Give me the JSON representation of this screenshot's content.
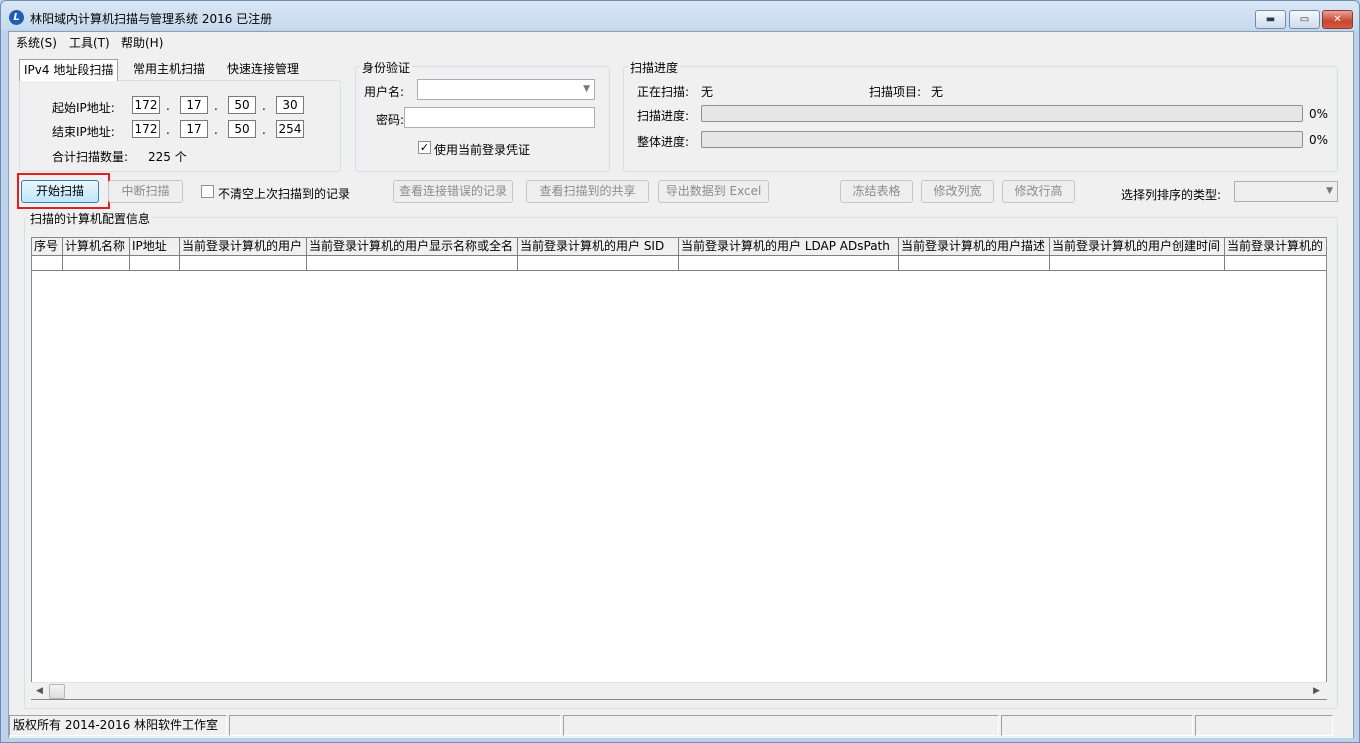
{
  "window": {
    "title": "林阳域内计算机扫描与管理系统 2016 已注册",
    "app_icon_glyph": "L",
    "min_glyph": "▬",
    "max_glyph": "▭",
    "close_glyph": "✕"
  },
  "menu": [
    "系统(S)",
    "工具(T)",
    "帮助(H)"
  ],
  "tabs": [
    "IPv4 地址段扫描",
    "常用主机扫描",
    "快速连接管理"
  ],
  "ip_range": {
    "start_label": "起始IP地址:",
    "start": [
      "172",
      "17",
      "50",
      "30"
    ],
    "end_label": "结束IP地址:",
    "end": [
      "172",
      "17",
      "50",
      "254"
    ],
    "dot": ".",
    "count_label": "合计扫描数量:",
    "count_value": "225 个"
  },
  "auth": {
    "title": "身份验证",
    "username_label": "用户名:",
    "username_value": "",
    "password_label": "密码:",
    "use_current_label": "使用当前登录凭证",
    "use_current_checked": "✓"
  },
  "progress": {
    "title": "扫描进度",
    "scanning_label": "正在扫描:",
    "scanning_value": "无",
    "item_label": "扫描项目:",
    "item_value": "无",
    "scan_progress_label": "扫描进度:",
    "scan_progress_pct": "0%",
    "scan_progress_value": 0,
    "overall_label": "整体进度:",
    "overall_pct": "0%",
    "overall_value": 0
  },
  "toolbar": {
    "start": "开始扫描",
    "stop": "中断扫描",
    "keep_records": "不清空上次扫描到的记录",
    "view_errors": "查看连接错误的记录",
    "view_shares": "查看扫描到的共享",
    "export_excel": "导出数据到 Excel",
    "freeze": "冻结表格",
    "col_width": "修改列宽",
    "row_height": "修改行高",
    "sort_label": "选择列排序的类型:",
    "sort_value": ""
  },
  "grid": {
    "title": "扫描的计算机配置信息",
    "columns": [
      "序号",
      "计算机名称",
      "IP地址",
      "当前登录计算机的用户",
      "当前登录计算机的用户显示名称或全名",
      "当前登录计算机的用户 SID",
      "当前登录计算机的用户 LDAP ADsPath",
      "当前登录计算机的用户描述",
      "当前登录计算机的用户创建时间",
      "当前登录计算机的"
    ]
  },
  "scrollbar": {
    "left_arrow": "◀",
    "right_arrow": "▶"
  },
  "status": {
    "copyright": "版权所有 2014-2016 林阳软件工作室"
  }
}
